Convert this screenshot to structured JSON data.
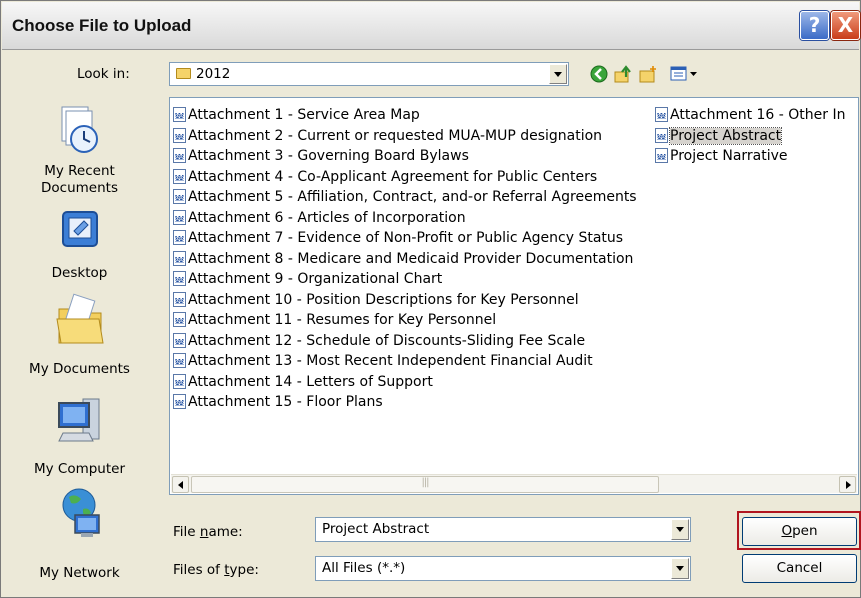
{
  "window": {
    "title": "Choose File to Upload",
    "help_glyph": "?",
    "close_glyph": "X"
  },
  "toolbar": {
    "look_in_label": "Look in:",
    "look_in_value": "2012",
    "icons": [
      "back-icon",
      "up-folder-icon",
      "new-folder-icon",
      "views-menu-icon"
    ]
  },
  "places": [
    {
      "label": "My Recent Documents",
      "icon": "recent-documents-icon"
    },
    {
      "label": "Desktop",
      "icon": "desktop-icon"
    },
    {
      "label": "My Documents",
      "icon": "my-documents-icon"
    },
    {
      "label": "My Computer",
      "icon": "my-computer-icon"
    },
    {
      "label": "My Network",
      "icon": "my-network-icon"
    }
  ],
  "files": {
    "column1": [
      "Attachment 1 - Service Area Map",
      "Attachment 2 - Current or requested MUA-MUP designation",
      "Attachment 3 - Governing Board Bylaws",
      "Attachment 4 - Co-Applicant Agreement for Public Centers",
      "Attachment 5 - Affiliation, Contract, and-or Referral Agreements",
      "Attachment 6 - Articles of Incorporation",
      "Attachment 7 - Evidence of Non-Profit or Public Agency Status",
      "Attachment 8 - Medicare and Medicaid Provider Documentation",
      "Attachment 9 - Organizational Chart",
      "Attachment 10 - Position Descriptions for Key Personnel",
      "Attachment 11 - Resumes for Key Personnel",
      "Attachment 12 - Schedule of Discounts-Sliding Fee Scale",
      "Attachment 13 - Most Recent Independent Financial Audit",
      "Attachment 14 - Letters of Support",
      "Attachment 15 - Floor Plans"
    ],
    "column2": [
      "Attachment 16 - Other In",
      "Project Abstract",
      "Project Narrative"
    ],
    "selected": "Project Abstract"
  },
  "footer": {
    "file_name_label_pre": "File ",
    "file_name_label_key": "n",
    "file_name_label_post": "ame:",
    "file_name_value": "Project Abstract",
    "file_type_label_pre": "Files of ",
    "file_type_label_key": "t",
    "file_type_label_post": "ype:",
    "file_type_value": "All Files (*.*)",
    "open_key": "O",
    "open_rest": "pen",
    "cancel_label": "Cancel"
  },
  "colors": {
    "dialog_bg": "#ece9d8",
    "highlight_border": "#b0151f",
    "close_button": "#c93d1a",
    "help_button": "#3b6bc7"
  }
}
